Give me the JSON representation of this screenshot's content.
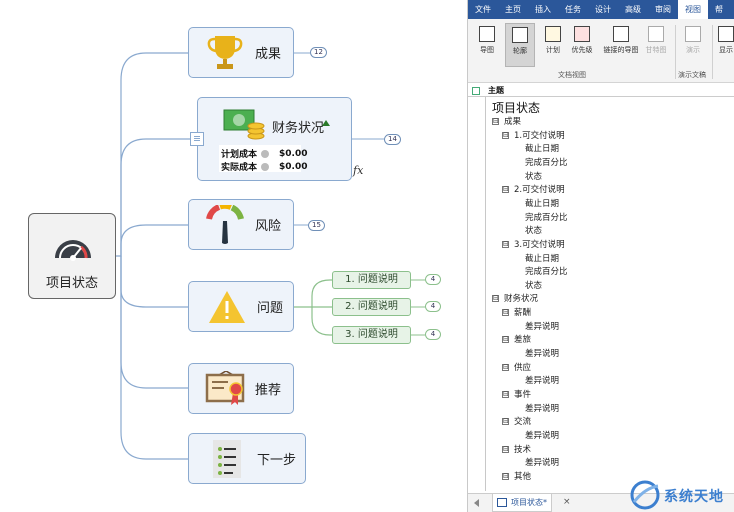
{
  "colors": {
    "accent": "#2b579a",
    "node_border": "#8aa9cf",
    "node_fill": "#eef3fa",
    "sub_fill": "#e7f3e7",
    "sub_border": "#8cc08c",
    "link": "#8aa9cf",
    "sub_link": "#8cc08c"
  },
  "mindmap": {
    "central": {
      "label": "项目状态",
      "icon": "gauge-icon"
    },
    "branches": [
      {
        "label": "成果",
        "icon": "trophy-icon",
        "badge": "12"
      },
      {
        "label": "财务状况",
        "icon": "money-icon",
        "badge": "14",
        "costs": [
          {
            "label": "计划成本",
            "value": "$0.00"
          },
          {
            "label": "实际成本",
            "value": "$0.00"
          }
        ]
      },
      {
        "label": "风险",
        "icon": "risk-gauge-icon",
        "badge": "15"
      },
      {
        "label": "问题",
        "icon": "warning-icon",
        "children": [
          {
            "label": "1. 问题说明",
            "badge": "4"
          },
          {
            "label": "2. 问题说明",
            "badge": "4"
          },
          {
            "label": "3. 问题说明",
            "badge": "4"
          }
        ]
      },
      {
        "label": "推荐",
        "icon": "certificate-icon"
      },
      {
        "label": "下一步",
        "icon": "checklist-icon"
      }
    ],
    "fx_label": "fx"
  },
  "ribbon": {
    "tabs": [
      "文件",
      "主页",
      "插入",
      "任务",
      "设计",
      "高级",
      "审阅",
      "视图",
      "帮"
    ],
    "active_tab": "视图",
    "buttons": [
      {
        "label": "导图",
        "icon": "map-view-icon"
      },
      {
        "label": "轮廓",
        "icon": "outline-view-icon"
      },
      {
        "label": "计划",
        "icon": "calendar-24-icon"
      },
      {
        "label": "优先级",
        "icon": "priority-icon"
      },
      {
        "label": "链接的导图",
        "icon": "linked-maps-icon"
      },
      {
        "label": "甘特图",
        "icon": "gantt-icon"
      },
      {
        "label": "演示",
        "icon": "present-icon"
      },
      {
        "label": "显示",
        "icon": "display-icon"
      }
    ],
    "groups": [
      "文档视图",
      "演示文稿"
    ]
  },
  "outline": {
    "header": "主题",
    "rows": [
      {
        "text": "项目状态",
        "level": 0
      },
      {
        "text": "成果",
        "level": 1,
        "toggle": "⊟"
      },
      {
        "text": "1.可交付说明",
        "level": 2,
        "toggle": "⊟"
      },
      {
        "text": "截止日期",
        "level": 3
      },
      {
        "text": "完成百分比",
        "level": 3
      },
      {
        "text": "状态",
        "level": 3
      },
      {
        "text": "2.可交付说明",
        "level": 2,
        "toggle": "⊟"
      },
      {
        "text": "截止日期",
        "level": 3
      },
      {
        "text": "完成百分比",
        "level": 3
      },
      {
        "text": "状态",
        "level": 3
      },
      {
        "text": "3.可交付说明",
        "level": 2,
        "toggle": "⊟"
      },
      {
        "text": "截止日期",
        "level": 3
      },
      {
        "text": "完成百分比",
        "level": 3
      },
      {
        "text": "状态",
        "level": 3
      },
      {
        "text": "财务状况",
        "level": 1,
        "toggle": "⊟"
      },
      {
        "text": "薪酬",
        "level": 2,
        "toggle": "⊟"
      },
      {
        "text": "差异说明",
        "level": 3
      },
      {
        "text": "差旅",
        "level": 2,
        "toggle": "⊟"
      },
      {
        "text": "差异说明",
        "level": 3
      },
      {
        "text": "供应",
        "level": 2,
        "toggle": "⊟"
      },
      {
        "text": "差异说明",
        "level": 3
      },
      {
        "text": "事件",
        "level": 2,
        "toggle": "⊟"
      },
      {
        "text": "差异说明",
        "level": 3
      },
      {
        "text": "交流",
        "level": 2,
        "toggle": "⊟"
      },
      {
        "text": "差异说明",
        "level": 3
      },
      {
        "text": "技术",
        "level": 2,
        "toggle": "⊟"
      },
      {
        "text": "差异说明",
        "level": 3
      },
      {
        "text": "其他",
        "level": 2,
        "toggle": "⊟"
      }
    ]
  },
  "doc_tab": {
    "label": "项目状态*",
    "close": "×"
  },
  "watermark": {
    "text": "系统天地"
  }
}
